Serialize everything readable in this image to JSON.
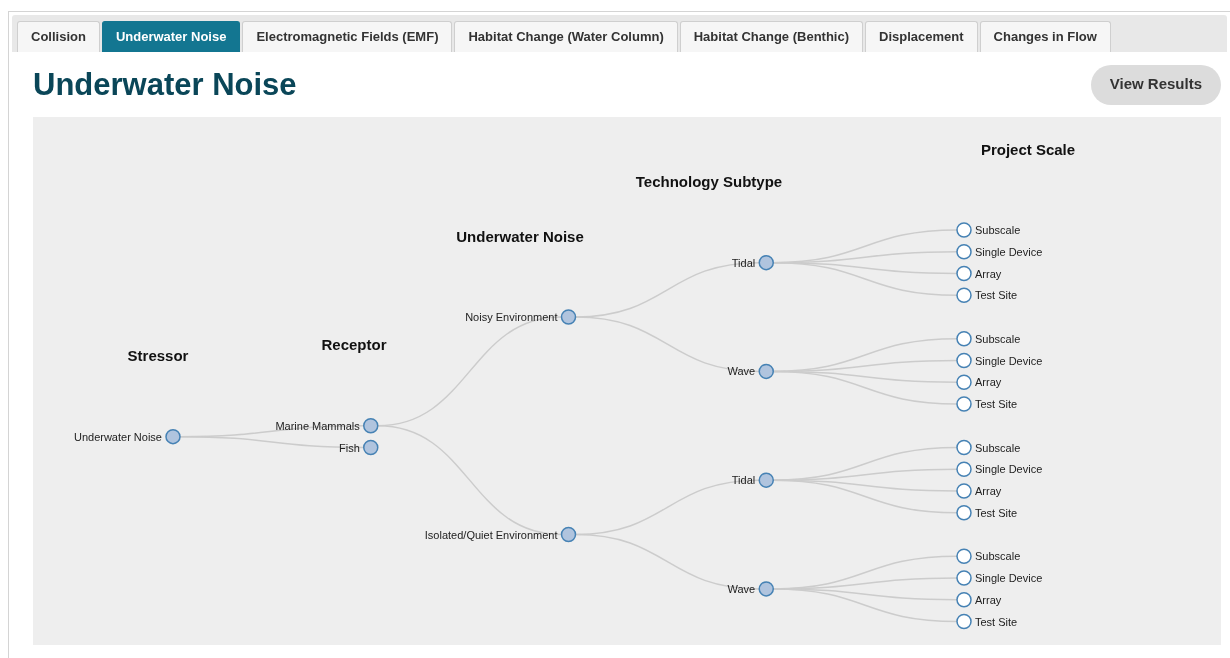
{
  "tabs": [
    {
      "label": "Collision",
      "selected": false
    },
    {
      "label": "Underwater Noise",
      "selected": true
    },
    {
      "label": "Electromagnetic Fields (EMF)",
      "selected": false
    },
    {
      "label": "Habitat Change (Water Column)",
      "selected": false
    },
    {
      "label": "Habitat Change (Benthic)",
      "selected": false
    },
    {
      "label": "Displacement",
      "selected": false
    },
    {
      "label": "Changes in Flow",
      "selected": false
    }
  ],
  "title": "Underwater Noise",
  "view_results_button": "View Results",
  "diagram": {
    "level_headings": [
      "Stressor",
      "Receptor",
      "Underwater Noise",
      "Technology Subtype",
      "Project Scale"
    ],
    "tree": {
      "label": "Underwater Noise",
      "has_children": true,
      "children": [
        {
          "label": "Marine Mammals",
          "has_children": true,
          "children": [
            {
              "label": "Noisy Environment",
              "has_children": true,
              "children": [
                {
                  "label": "Tidal",
                  "has_children": true,
                  "children": [
                    {
                      "label": "Subscale",
                      "has_children": false
                    },
                    {
                      "label": "Single Device",
                      "has_children": false
                    },
                    {
                      "label": "Array",
                      "has_children": false
                    },
                    {
                      "label": "Test Site",
                      "has_children": false
                    }
                  ]
                },
                {
                  "label": "Wave",
                  "has_children": true,
                  "children": [
                    {
                      "label": "Subscale",
                      "has_children": false
                    },
                    {
                      "label": "Single Device",
                      "has_children": false
                    },
                    {
                      "label": "Array",
                      "has_children": false
                    },
                    {
                      "label": "Test Site",
                      "has_children": false
                    }
                  ]
                }
              ]
            },
            {
              "label": "Isolated/Quiet Environment",
              "has_children": true,
              "children": [
                {
                  "label": "Tidal",
                  "has_children": true,
                  "children": [
                    {
                      "label": "Subscale",
                      "has_children": false
                    },
                    {
                      "label": "Single Device",
                      "has_children": false
                    },
                    {
                      "label": "Array",
                      "has_children": false
                    },
                    {
                      "label": "Test Site",
                      "has_children": false
                    }
                  ]
                },
                {
                  "label": "Wave",
                  "has_children": true,
                  "children": [
                    {
                      "label": "Subscale",
                      "has_children": false
                    },
                    {
                      "label": "Single Device",
                      "has_children": false
                    },
                    {
                      "label": "Array",
                      "has_children": false
                    },
                    {
                      "label": "Test Site",
                      "has_children": false
                    }
                  ]
                }
              ]
            }
          ]
        },
        {
          "label": "Fish",
          "has_children": true
        }
      ]
    }
  }
}
